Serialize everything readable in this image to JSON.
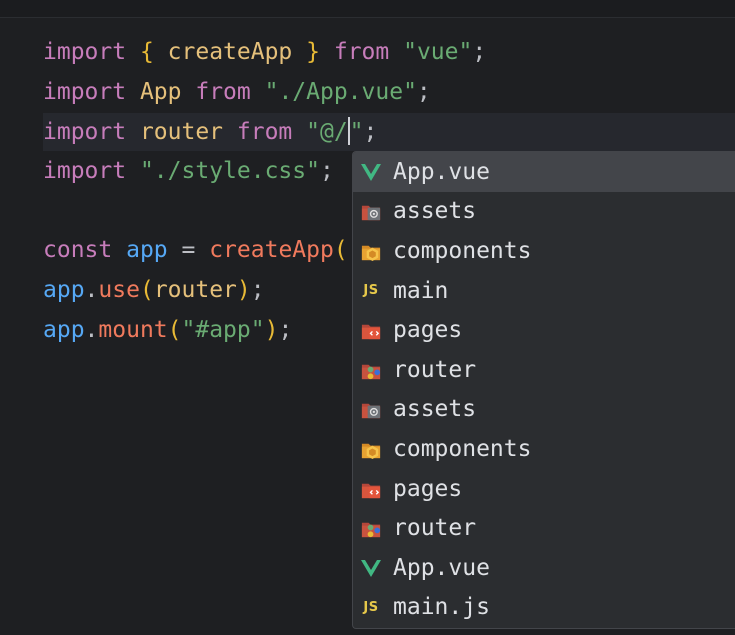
{
  "editor": {
    "lines": [
      {
        "tokens": [
          {
            "t": "import",
            "c": "kw"
          },
          {
            "t": " ",
            "c": "plain"
          },
          {
            "t": "{",
            "c": "brace"
          },
          {
            "t": " createApp ",
            "c": "ident"
          },
          {
            "t": "}",
            "c": "brace"
          },
          {
            "t": " from ",
            "c": "kw"
          },
          {
            "t": "\"vue\"",
            "c": "str"
          },
          {
            "t": ";",
            "c": "plain"
          }
        ]
      },
      {
        "tokens": [
          {
            "t": "import",
            "c": "kw"
          },
          {
            "t": " App ",
            "c": "ident"
          },
          {
            "t": "from",
            "c": "kw"
          },
          {
            "t": " ",
            "c": "plain"
          },
          {
            "t": "\"./App.vue\"",
            "c": "str"
          },
          {
            "t": ";",
            "c": "plain"
          }
        ]
      },
      {
        "current": true,
        "tokens": [
          {
            "t": "import",
            "c": "kw"
          },
          {
            "t": " router ",
            "c": "ident"
          },
          {
            "t": "from",
            "c": "kw"
          },
          {
            "t": " ",
            "c": "plain"
          },
          {
            "t": "\"@/",
            "c": "str"
          },
          {
            "caret": true
          },
          {
            "t": "\"",
            "c": "str"
          },
          {
            "t": ";",
            "c": "plain"
          }
        ]
      },
      {
        "tokens": [
          {
            "t": "import",
            "c": "kw"
          },
          {
            "t": " ",
            "c": "plain"
          },
          {
            "t": "\"./style.css\"",
            "c": "str"
          },
          {
            "t": ";",
            "c": "plain"
          }
        ]
      },
      {
        "tokens": []
      },
      {
        "tokens": [
          {
            "t": "const",
            "c": "kw"
          },
          {
            "t": " ",
            "c": "plain"
          },
          {
            "t": "app",
            "c": "var"
          },
          {
            "t": " = ",
            "c": "plain"
          },
          {
            "t": "createApp",
            "c": "fn"
          },
          {
            "t": "(",
            "c": "paren"
          }
        ]
      },
      {
        "tokens": [
          {
            "t": "app",
            "c": "var"
          },
          {
            "t": ".",
            "c": "plain"
          },
          {
            "t": "use",
            "c": "fn"
          },
          {
            "t": "(",
            "c": "paren"
          },
          {
            "t": "router",
            "c": "ident"
          },
          {
            "t": ")",
            "c": "paren"
          },
          {
            "t": ";",
            "c": "plain"
          }
        ]
      },
      {
        "tokens": [
          {
            "t": "app",
            "c": "var"
          },
          {
            "t": ".",
            "c": "plain"
          },
          {
            "t": "mount",
            "c": "fn"
          },
          {
            "t": "(",
            "c": "paren"
          },
          {
            "t": "\"#app\"",
            "c": "str"
          },
          {
            "t": ")",
            "c": "paren"
          },
          {
            "t": ";",
            "c": "plain"
          }
        ]
      }
    ]
  },
  "completion": {
    "items": [
      {
        "label": "App.vue",
        "icon": "vue-icon",
        "selected": true
      },
      {
        "label": "assets",
        "icon": "folder-assets-icon"
      },
      {
        "label": "components",
        "icon": "folder-components-icon"
      },
      {
        "label": "main",
        "icon": "js-icon"
      },
      {
        "label": "pages",
        "icon": "folder-pages-icon"
      },
      {
        "label": "router",
        "icon": "folder-router-icon"
      },
      {
        "label": "assets",
        "icon": "folder-assets-icon"
      },
      {
        "label": "components",
        "icon": "folder-components-icon"
      },
      {
        "label": "pages",
        "icon": "folder-pages-icon"
      },
      {
        "label": "router",
        "icon": "folder-router-icon"
      },
      {
        "label": "App.vue",
        "icon": "vue-icon"
      },
      {
        "label": "main.js",
        "icon": "js-icon"
      }
    ],
    "js_icon_text": "JS"
  },
  "colors": {
    "background": "#1e1f22",
    "popup_background": "#2b2d30",
    "selection": "#43454a",
    "keyword": "#c77dbb",
    "string": "#6aab73",
    "vue_green": "#41b883"
  }
}
